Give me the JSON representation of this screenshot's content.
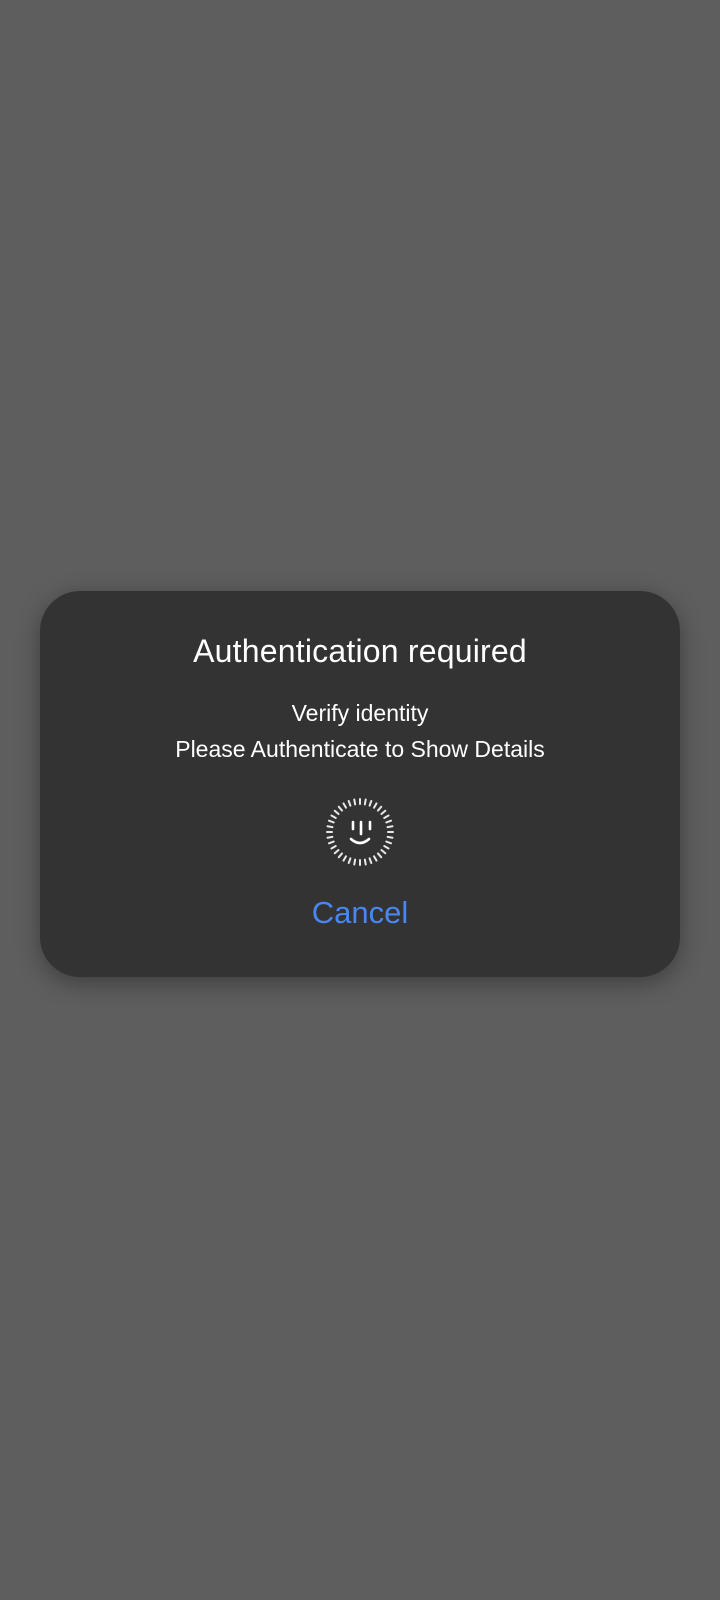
{
  "dialog": {
    "title": "Authentication required",
    "subtitle": "Verify identity",
    "description": "Please Authenticate to Show Details",
    "icon": "face-unlock-icon",
    "cancel_label": "Cancel"
  },
  "colors": {
    "scrim": "#5e5e5e",
    "dialog_background": "#333333",
    "text": "#ffffff",
    "accent": "#4a86ef"
  }
}
